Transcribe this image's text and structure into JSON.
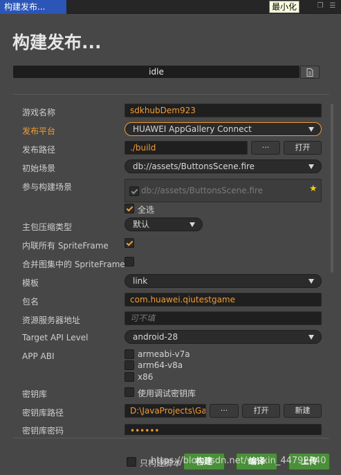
{
  "window": {
    "tab_title": "构建发布...",
    "minimize_tooltip": "最小化",
    "restore_icon": "restore-icon",
    "menu_icon": "menu-icon"
  },
  "page_title": "构建发布...",
  "progress": {
    "status": "idle",
    "log_icon": "document-icon"
  },
  "fields": {
    "game_name": {
      "label": "游戏名称",
      "value": "sdkhubDem923"
    },
    "platform": {
      "label": "发布平台",
      "value": "HUAWEI AppGallery Connect"
    },
    "build_path": {
      "label": "发布路径",
      "value": "./build",
      "browse_label": "···",
      "open_label": "打开"
    },
    "start_scene": {
      "label": "初始场景",
      "value": "db://assets/ButtonsScene.fire"
    },
    "included_scenes": {
      "label": "参与构建场景",
      "scene": "db://assets/ButtonsScene.fire",
      "select_all": "全选"
    },
    "compression": {
      "label": "主包压缩类型",
      "value": "默认"
    },
    "inline_spriteframe": {
      "label": "内联所有 SpriteFrame"
    },
    "merge_spriteframe": {
      "label": "合并图集中的 SpriteFrame"
    },
    "template": {
      "label": "模板",
      "value": "link"
    },
    "package_name": {
      "label": "包名",
      "value": "com.huawei.qiutestgame"
    },
    "resource_server": {
      "label": "资源服务器地址",
      "placeholder": "可不填"
    },
    "target_api": {
      "label": "Target API Level",
      "value": "android-28"
    },
    "app_abi": {
      "label": "APP ABI",
      "options": [
        "armeabi-v7a",
        "arm64-v8a",
        "x86"
      ]
    },
    "keystore": {
      "label": "密钥库",
      "option": "使用调试密钥库"
    },
    "keystore_path": {
      "label": "密钥库路径",
      "value": "D:\\JavaProjects\\Gar",
      "browse_label": "···",
      "open_label": "打开",
      "new_label": "新建"
    },
    "keystore_password": {
      "label": "密钥库密码",
      "value": "••••••"
    }
  },
  "footer": {
    "build_only": "只构建脚本",
    "build_button": "构建",
    "compile_button": "编译",
    "publish_button": "上传",
    "watermark": "https://blog.csdn.net/weixin_44792240"
  },
  "colors": {
    "accent": "#f39c33",
    "tab_blue": "#2b56b8",
    "button_green": "#4b8f3a"
  }
}
